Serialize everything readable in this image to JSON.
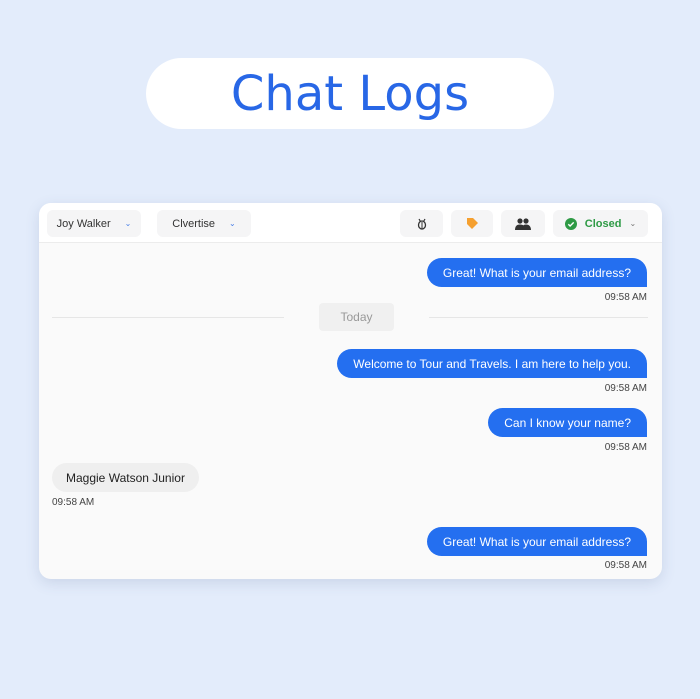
{
  "title": "Chat Logs",
  "header": {
    "agent": "Joy Walker",
    "brand": "Clvertise",
    "status": "Closed",
    "icons": [
      "bug-icon",
      "tag-icon",
      "people-icon",
      "check-circle-icon"
    ]
  },
  "divider": "Today",
  "messages": [
    {
      "side": "out",
      "text": "Great! What is your email address?",
      "time": "09:58 AM"
    },
    {
      "side": "out",
      "text": "Welcome to Tour and Travels. I am here to help you.",
      "time": "09:58 AM"
    },
    {
      "side": "out",
      "text": "Can I know your name?",
      "time": "09:58 AM"
    },
    {
      "side": "in",
      "text": "Maggie Watson Junior",
      "time": "09:58 AM"
    },
    {
      "side": "out",
      "text": "Great! What is your email address?",
      "time": "09:58 AM"
    }
  ],
  "colors": {
    "accent": "#246ff0",
    "status": "#2e9a45",
    "tag": "#f5a030",
    "background": "#e3ecfb"
  }
}
